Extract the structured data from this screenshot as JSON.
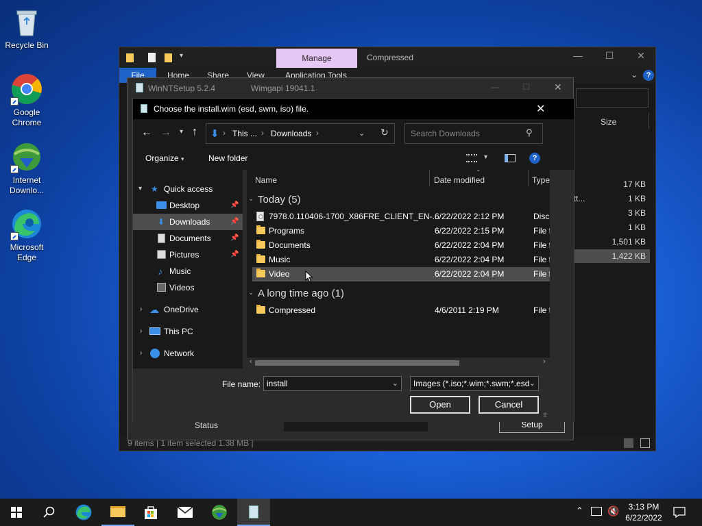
{
  "desktop": {
    "icons": [
      {
        "label": "Recycle Bin",
        "icon": "recycle-bin-icon"
      },
      {
        "label": "Google Chrome",
        "icon": "chrome-icon"
      },
      {
        "label": "Internet Downlo...",
        "icon": "internet-download-manager-icon"
      },
      {
        "label": "Microsoft Edge",
        "icon": "edge-icon"
      }
    ]
  },
  "explorer": {
    "manage_tab": "Manage",
    "title": "Compressed",
    "ribbon": {
      "file": "File",
      "home": "Home",
      "share": "Share",
      "view": "View",
      "app_tools": "Application Tools"
    },
    "size_header": "Size",
    "sizes": [
      "17 KB",
      "1 KB",
      "3 KB",
      "1 KB",
      "1,501 KB",
      "1,422 KB"
    ],
    "partial_text": "ett...",
    "status": "9 items  |  1 item selected  1.38 MB  |"
  },
  "winntsetup": {
    "title": "WinNTSetup 5.2.4",
    "subtitle": "Wimgapi 19041.1",
    "status_label": "Status",
    "setup_button": "Setup"
  },
  "dialog": {
    "title": "Choose the install.wim (esd, swm, iso) file.",
    "breadcrumb": [
      "This ...",
      "Downloads"
    ],
    "search_placeholder": "Search Downloads",
    "organize": "Organize",
    "new_folder": "New folder",
    "nav": [
      {
        "label": "Quick access",
        "icon": "star-icon"
      },
      {
        "label": "Desktop",
        "icon": "desktop-folder-icon",
        "pinned": true
      },
      {
        "label": "Downloads",
        "icon": "download-arrow-icon",
        "pinned": true,
        "selected": true
      },
      {
        "label": "Documents",
        "icon": "documents-icon",
        "pinned": true
      },
      {
        "label": "Pictures",
        "icon": "pictures-icon",
        "pinned": true
      },
      {
        "label": "Music",
        "icon": "music-note-icon"
      },
      {
        "label": "Videos",
        "icon": "videos-icon"
      },
      {
        "label": "OneDrive",
        "icon": "cloud-icon"
      },
      {
        "label": "This PC",
        "icon": "computer-icon"
      },
      {
        "label": "Network",
        "icon": "network-icon"
      }
    ],
    "columns": {
      "name": "Name",
      "date": "Date modified",
      "type": "Type"
    },
    "groups": [
      {
        "label": "Today (5)",
        "rows": [
          {
            "name": "7978.0.110406-1700_X86FRE_CLIENT_EN-...",
            "date": "6/22/2022 2:12 PM",
            "type": "Disc I",
            "icon": "disc-image-icon"
          },
          {
            "name": "Programs",
            "date": "6/22/2022 2:15 PM",
            "type": "File fo",
            "icon": "folder-icon"
          },
          {
            "name": "Documents",
            "date": "6/22/2022 2:04 PM",
            "type": "File fo",
            "icon": "folder-icon"
          },
          {
            "name": "Music",
            "date": "6/22/2022 2:04 PM",
            "type": "File fo",
            "icon": "folder-icon"
          },
          {
            "name": "Video",
            "date": "6/22/2022 2:04 PM",
            "type": "File fo",
            "icon": "folder-icon",
            "selected": true
          }
        ]
      },
      {
        "label": "A long time ago (1)",
        "rows": [
          {
            "name": "Compressed",
            "date": "4/6/2011 2:19 PM",
            "type": "File fo",
            "icon": "folder-icon"
          }
        ]
      }
    ],
    "file_name_label": "File name:",
    "file_name_value": "install",
    "filter": "Images (*.iso;*.wim;*.swm;*.esd",
    "open": "Open",
    "cancel": "Cancel"
  },
  "taskbar": {
    "time": "3:13 PM",
    "date": "6/22/2022"
  }
}
